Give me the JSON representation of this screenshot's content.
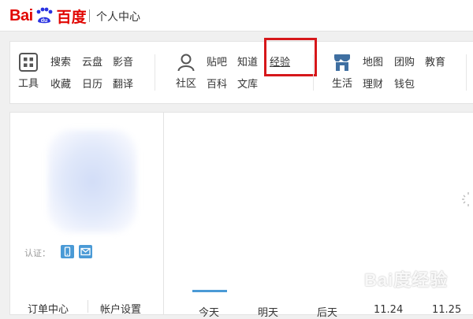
{
  "header": {
    "logo_prefix": "Bai",
    "logo_suffix": "du",
    "logo_cn": "百度",
    "title": "个人中心"
  },
  "nav": {
    "tools_label": "工具",
    "tools_links": [
      "搜索",
      "云盘",
      "影音",
      "收藏",
      "日历",
      "翻译"
    ],
    "community_label": "社区",
    "community_links": [
      "贴吧",
      "知道",
      "经验",
      "百科",
      "文库"
    ],
    "life_label": "生活",
    "life_links": [
      "地图",
      "团购",
      "教育",
      "理财",
      "钱包"
    ]
  },
  "profile": {
    "verify_label": "认证：",
    "orders_label": "订单中心",
    "account_label": "帐户设置"
  },
  "dates": [
    "今天",
    "明天",
    "后天",
    "11.24",
    "11.25"
  ],
  "watermark": "Bai度经验",
  "colors": {
    "brand_red": "#e10602",
    "accent_blue": "#4a9ad6",
    "highlight_red": "#d6171a",
    "life_icon": "#3f6fa1"
  }
}
